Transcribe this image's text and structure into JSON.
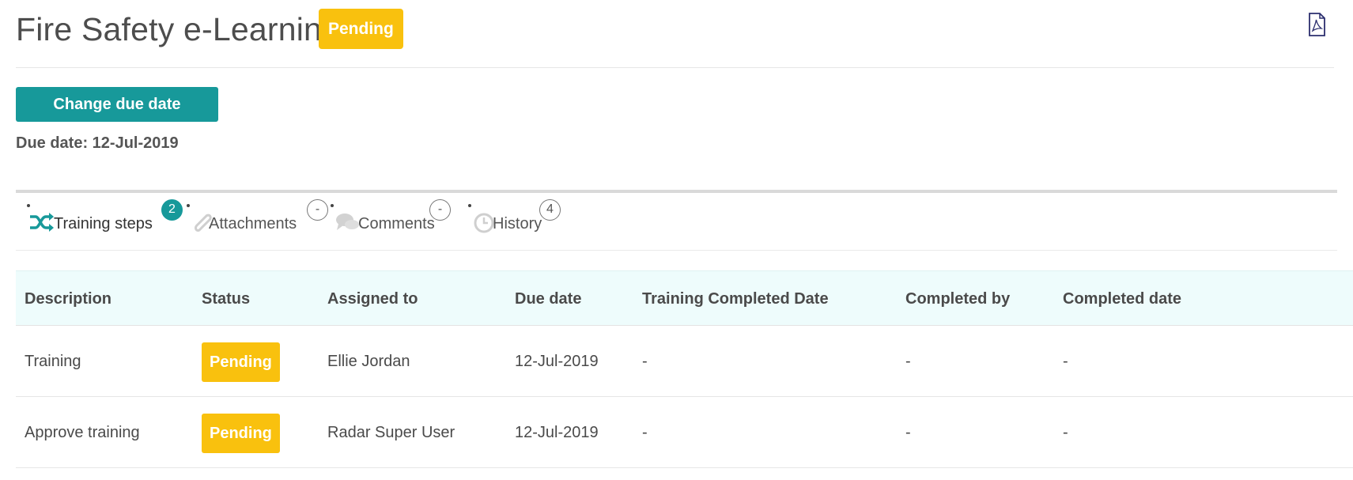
{
  "header": {
    "title": "Fire Safety e-Learning",
    "status_badge": "Pending",
    "pdf_icon": "pdf-file-icon"
  },
  "actions": {
    "change_due_date_label": "Change due date",
    "due_date_text": "Due date: 12-Jul-2019"
  },
  "tabs": [
    {
      "label": "Training steps",
      "count": "2",
      "icon": "shuffle-icon",
      "active": true
    },
    {
      "label": "Attachments",
      "count": "-",
      "icon": "paperclip-icon",
      "active": false
    },
    {
      "label": "Comments",
      "count": "-",
      "icon": "comments-icon",
      "active": false
    },
    {
      "label": "History",
      "count": "4",
      "icon": "clock-icon",
      "active": false
    }
  ],
  "table": {
    "columns": [
      "Description",
      "Status",
      "Assigned to",
      "Due date",
      "Training Completed Date",
      "Completed by",
      "Completed date"
    ],
    "rows": [
      {
        "description": "Training",
        "status": "Pending",
        "assigned_to": "Ellie Jordan",
        "due_date": "12-Jul-2019",
        "training_completed_date": "-",
        "completed_by": "-",
        "completed_date": "-"
      },
      {
        "description": "Approve training",
        "status": "Pending",
        "assigned_to": "Radar Super User",
        "due_date": "12-Jul-2019",
        "training_completed_date": "-",
        "completed_by": "-",
        "completed_date": "-"
      }
    ]
  },
  "colors": {
    "accent": "#17999a",
    "pending": "#f9c10e",
    "header_row_bg": "#eefcfc"
  }
}
